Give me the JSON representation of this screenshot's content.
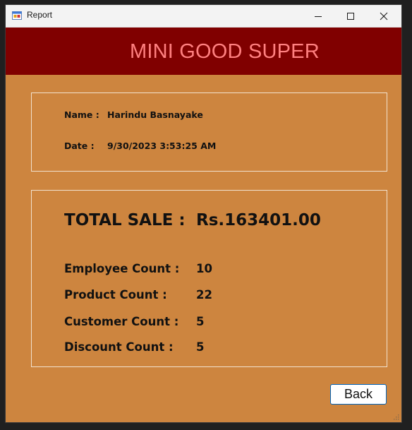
{
  "window": {
    "title": "Report",
    "icon": "app-form-icon",
    "controls": [
      "minimize-icon",
      "maximize-icon",
      "close-icon"
    ]
  },
  "header": {
    "brand": "MINI GOOD SUPER"
  },
  "info": {
    "name_label": "Name :",
    "name_value": "Harindu Basnayake",
    "date_label": "Date :",
    "date_value": "9/30/2023 3:53:25 AM"
  },
  "stats": {
    "total_label": "TOTAL SALE :",
    "total_value": "Rs.163401.00",
    "employee_label": "Employee Count :",
    "employee_value": "10",
    "product_label": "Product Count :",
    "product_value": "22",
    "customer_label": "Customer Count :",
    "customer_value": "5",
    "discount_label": "Discount Count :",
    "discount_value": "5"
  },
  "actions": {
    "back_label": "Back"
  },
  "colors": {
    "background": "#cd853f",
    "header": "#800000",
    "brand_text": "#ff8080",
    "button_border": "#0067c0"
  }
}
